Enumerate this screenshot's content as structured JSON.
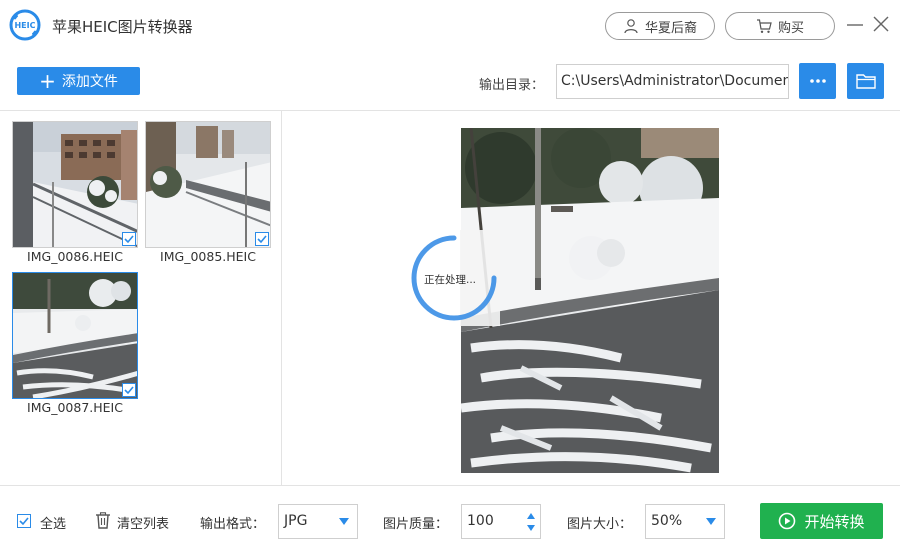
{
  "titlebar": {
    "logo_text": "HEIC",
    "title": "苹果HEIC图片转换器",
    "account_label": "华夏后裔",
    "buy_label": "购买"
  },
  "toolbar": {
    "add_file_label": "添加文件",
    "output_dir_label": "输出目录：",
    "output_dir_value": "C:\\Users\\Administrator\\Documents"
  },
  "files": [
    {
      "name": "IMG_0086.HEIC",
      "checked": true,
      "selected": false
    },
    {
      "name": "IMG_0085.HEIC",
      "checked": true,
      "selected": false
    },
    {
      "name": "IMG_0087.HEIC",
      "checked": true,
      "selected": true
    }
  ],
  "preview": {
    "status": "正在处理..."
  },
  "bottombar": {
    "select_all_label": "全选",
    "clear_list_label": "清空列表",
    "format_label": "输出格式：",
    "format_value": "JPG",
    "quality_label": "图片质量：",
    "quality_value": "100",
    "size_label": "图片大小：",
    "size_value": "50%",
    "start_label": "开始转换"
  },
  "colors": {
    "accent": "#2a8be8",
    "start_green": "#20b14f"
  }
}
